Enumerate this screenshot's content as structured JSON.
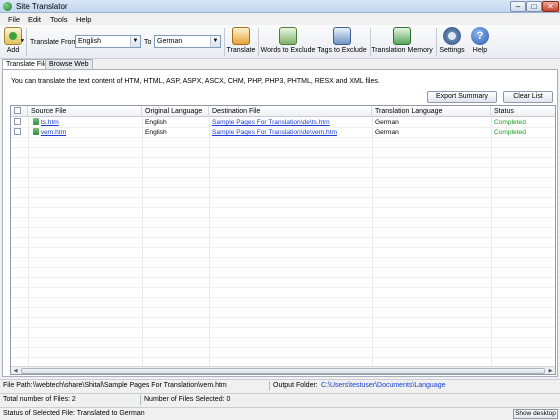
{
  "window": {
    "title": "Site Translator"
  },
  "menu": [
    "File",
    "Edit",
    "Tools",
    "Help"
  ],
  "toolbar": {
    "add_label": "Add",
    "translate_from_label": "Translate From",
    "from_lang": "English",
    "to_label": "To",
    "to_lang": "German",
    "translate_label": "Translate",
    "words_exclude_label": "Words to Exclude",
    "tags_exclude_label": "Tags to Exclude",
    "memory_label": "Translation Memory",
    "settings_label": "Settings",
    "help_label": "Help"
  },
  "tabs": [
    "Translate Files",
    "Browse Web"
  ],
  "panel": {
    "description": "You can translate the text content of HTM, HTML, ASP, ASPX, ASCX, CHM, PHP, PHP3, PHTML, RESX and XML files.",
    "export_label": "Export Summary",
    "clear_label": "Clear List"
  },
  "table": {
    "headers": [
      "Source File",
      "Original Language",
      "Destination File",
      "Translation Language",
      "Status"
    ],
    "rows": [
      {
        "source": "ts.htm",
        "orig": "English",
        "dest": "Sample Pages For Translation\\de\\ts.htm",
        "lang": "German",
        "status": "Completed"
      },
      {
        "source": "vem.htm",
        "orig": "English",
        "dest": "Sample Pages For Translation\\de\\vem.htm",
        "lang": "German",
        "status": "Completed"
      }
    ]
  },
  "status": {
    "file_path_label": "File Path:",
    "file_path": "\\\\webtech\\share\\Shital\\Sample Pages For Translation\\vem.htm",
    "output_label": "Output Folder:",
    "output_path": "C:\\Users\\testuser\\Documents\\Language",
    "total_files": "Total number of Files: 2",
    "selected_files": "Number of Files Selected: 0",
    "selected_status": "Status of Selected File: Translated to German",
    "show_desktop": "Show desktop"
  },
  "colors": {
    "link": "#1a3fd1",
    "completed": "#1d9a1d"
  }
}
